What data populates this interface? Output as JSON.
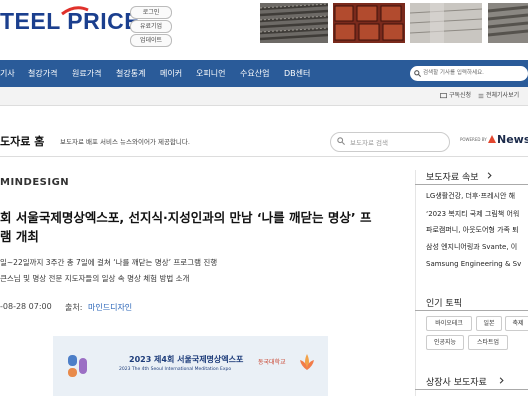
{
  "header": {
    "logo_text": "TEEL PRICE",
    "buttons": [
      "로그인",
      "유료기업",
      "업데이트"
    ]
  },
  "nav": {
    "items": [
      "기사",
      "철강가격",
      "원료가격",
      "철강통계",
      "메이커",
      "오피니언",
      "수요산업",
      "DB센터"
    ],
    "search_placeholder": "검색할 기사를 입력하세요."
  },
  "util": {
    "subscribe": "구독신청",
    "all_articles": "전체기사보기"
  },
  "press": {
    "title": "도자료 홈",
    "description": "보도자료 배포 서비스 뉴스와이어가 제공합니다.",
    "search_placeholder": "보도자료 검색",
    "powered_by": "POWERED BY",
    "newswire": "News"
  },
  "article": {
    "brand": "MINDESIGN",
    "headline_line1": "회 서울국제명상엑스포, 선지식·지성인과의 만남 ‘나를 깨닫는 명상’ 프",
    "headline_line2": "램 개최",
    "sub_line1": "일~22일까지 3주간 총 7일에 걸쳐 ‘나를 깨닫는 명상’ 프로그램 진행",
    "sub_line2": "큰스님 및 명상 전문 지도자들의 일상 속 명상 체험 방법 소개",
    "date": "-08-28 07:00",
    "source_label": "출처:",
    "source_name": "마인드디자인",
    "expo_title": "2023 제4회 서울국제명상엑스포",
    "expo_subtitle": "2023 The 4th Seoul International Meditation Expo",
    "expo_org": "동국대학교"
  },
  "sidebar": {
    "press_news_title": "보도자료 속보",
    "news": [
      "LG생활건강, 더후·프레시안 해",
      "‘2023 복지티 국제 그림책 어워",
      "파로캠퍼니, 아웃도어형 가족 퇴",
      "삼성 엔지니어링과 Svante, 이",
      "Samsung Engineering & Sv"
    ],
    "hot_topics_title": "인기 토픽",
    "tags": [
      "바이오테크",
      "일본",
      "축제",
      "인공지능",
      "스타트업"
    ],
    "listed_title": "상장사 보도자료"
  }
}
